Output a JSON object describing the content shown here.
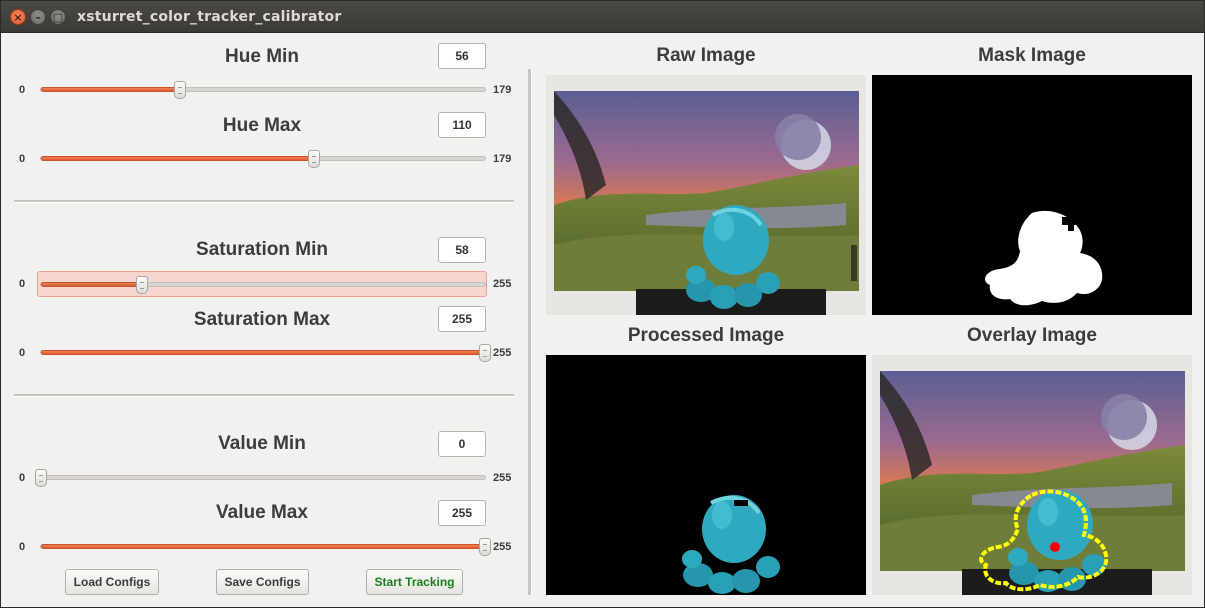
{
  "window": {
    "title": "xsturret_color_tracker_calibrator",
    "close_glyph": "×",
    "min_glyph": "–",
    "max_glyph": "□"
  },
  "controls": [
    {
      "title": "Hue Min",
      "value": "56",
      "min_label": "0",
      "max_label": "179",
      "min": 0,
      "max": 179,
      "current": 56,
      "focused": false
    },
    {
      "title": "Hue Max",
      "value": "110",
      "min_label": "0",
      "max_label": "179",
      "min": 0,
      "max": 179,
      "current": 110,
      "focused": false
    },
    {
      "title": "Saturation Min",
      "value": "58",
      "min_label": "0",
      "max_label": "255",
      "min": 0,
      "max": 255,
      "current": 58,
      "focused": true
    },
    {
      "title": "Saturation Max",
      "value": "255",
      "min_label": "0",
      "max_label": "255",
      "min": 0,
      "max": 255,
      "current": 255,
      "focused": false
    },
    {
      "title": "Value Min",
      "value": "0",
      "min_label": "0",
      "max_label": "255",
      "min": 0,
      "max": 255,
      "current": 0,
      "focused": false
    },
    {
      "title": "Value Max",
      "value": "255",
      "min_label": "0",
      "max_label": "255",
      "min": 0,
      "max": 255,
      "current": 255,
      "focused": false
    }
  ],
  "buttons": {
    "load": "Load Configs",
    "save": "Save Configs",
    "start": "Start Tracking"
  },
  "panels": {
    "raw": "Raw Image",
    "mask": "Mask Image",
    "processed": "Processed Image",
    "overlay": "Overlay Image"
  },
  "colors": {
    "accent": "#e9643a",
    "start_text": "#1b7f1b",
    "object": "#2fa9c0",
    "contour": "#ffff00",
    "centroid": "#ff0000"
  }
}
